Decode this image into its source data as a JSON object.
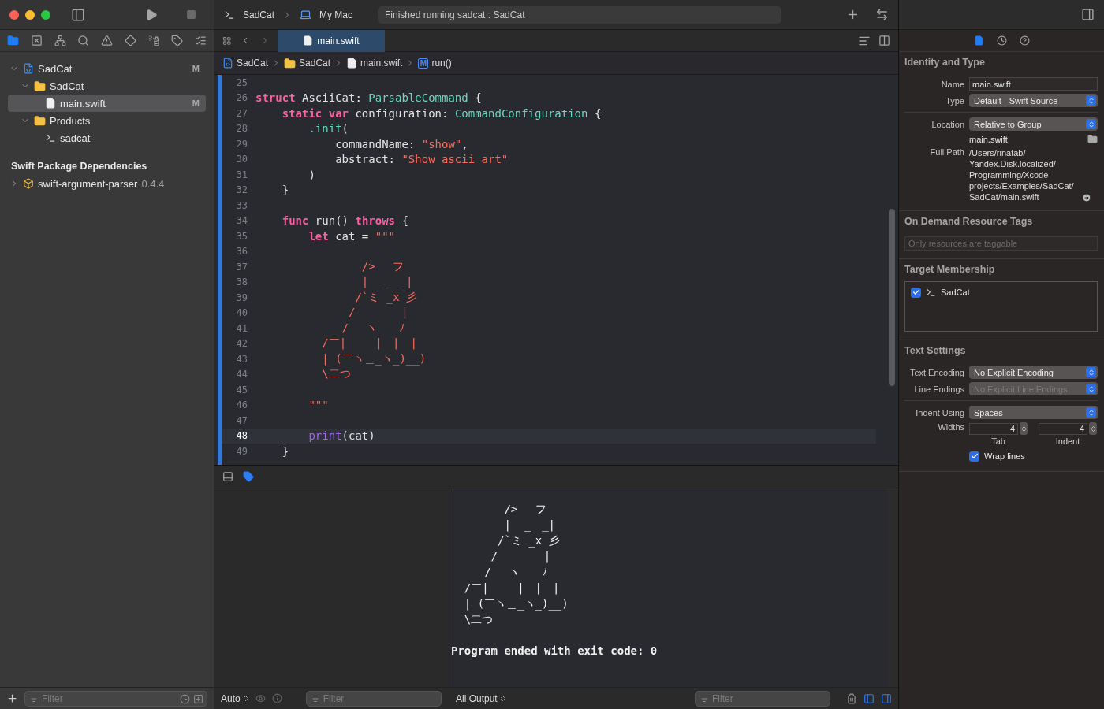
{
  "window": {
    "scheme": "SadCat",
    "destination": "My Mac",
    "status": "Finished running sadcat : SadCat"
  },
  "navigator_tabs": [
    {
      "kind": "folder",
      "selected": true
    },
    {
      "kind": "source-control",
      "selected": false
    },
    {
      "kind": "hierarchy",
      "selected": false
    },
    {
      "kind": "search",
      "selected": false
    },
    {
      "kind": "warning",
      "selected": false
    },
    {
      "kind": "test",
      "selected": false
    },
    {
      "kind": "debug",
      "selected": false
    },
    {
      "kind": "breakpoint",
      "selected": false
    },
    {
      "kind": "report",
      "selected": false
    }
  ],
  "navigator": {
    "tree": [
      {
        "name": "SadCat",
        "kind": "project",
        "badge": "M",
        "expanded": true,
        "selected": false,
        "children": [
          {
            "name": "SadCat",
            "kind": "folder",
            "expanded": true,
            "selected": false,
            "children": [
              {
                "name": "main.swift",
                "kind": "swift",
                "badge": "M",
                "selected": true
              }
            ]
          },
          {
            "name": "Products",
            "kind": "folder",
            "expanded": true,
            "selected": false,
            "children": [
              {
                "name": "sadcat",
                "kind": "executable",
                "selected": false
              }
            ]
          }
        ]
      }
    ],
    "dependencies_title": "Swift Package Dependencies",
    "packages": [
      {
        "name": "swift-argument-parser",
        "version": "0.4.4",
        "expanded": false,
        "selected": false
      }
    ],
    "filter": {
      "placeholder": "Filter"
    }
  },
  "editor": {
    "tab": "main.swift",
    "breadcrumb": [
      {
        "kind": "project",
        "label": "SadCat"
      },
      {
        "kind": "folder",
        "label": "SadCat"
      },
      {
        "kind": "swift",
        "label": "main.swift"
      },
      {
        "kind": "method",
        "icon_letter": "M",
        "label": "run()"
      }
    ],
    "lines": [
      {
        "number": "25",
        "current": false
      },
      {
        "number": "26",
        "current": false,
        "tokens": [
          {
            "kind": "keyword",
            "text": "struct"
          },
          {
            "kind": "plain",
            "text": " AsciiCat: "
          },
          {
            "kind": "type",
            "text": "ParsableCommand"
          },
          {
            "kind": "plain",
            "text": " {"
          }
        ]
      },
      {
        "number": "27",
        "current": false,
        "tokens": [
          {
            "kind": "keyword",
            "text": "    static "
          },
          {
            "kind": "keyword",
            "text": "var"
          },
          {
            "kind": "plain",
            "text": " configuration: "
          },
          {
            "kind": "type",
            "text": "CommandConfiguration"
          },
          {
            "kind": "plain",
            "text": " {"
          }
        ]
      },
      {
        "number": "28",
        "current": false,
        "tokens": [
          {
            "kind": "type",
            "text": "        .init"
          },
          {
            "kind": "plain",
            "text": "("
          }
        ]
      },
      {
        "number": "29",
        "current": false,
        "tokens": [
          {
            "kind": "plain",
            "text": "            commandName: "
          },
          {
            "kind": "string",
            "text": "\"show\""
          },
          {
            "kind": "plain",
            "text": ","
          }
        ]
      },
      {
        "number": "30",
        "current": false,
        "tokens": [
          {
            "kind": "plain",
            "text": "            abstract: "
          },
          {
            "kind": "string",
            "text": "\"Show ascii art\""
          }
        ]
      },
      {
        "number": "31",
        "current": false,
        "tokens": [
          {
            "kind": "plain",
            "text": "        )"
          }
        ]
      },
      {
        "number": "32",
        "current": false,
        "tokens": [
          {
            "kind": "plain",
            "text": "    }"
          }
        ]
      },
      {
        "number": "33",
        "current": false
      },
      {
        "number": "34",
        "current": false,
        "tokens": [
          {
            "kind": "keyword",
            "text": "    func"
          },
          {
            "kind": "plain",
            "text": " run() "
          },
          {
            "kind": "keyword",
            "text": "throws"
          },
          {
            "kind": "plain",
            "text": " {"
          }
        ]
      },
      {
        "number": "35",
        "current": false,
        "tokens": [
          {
            "kind": "keyword",
            "text": "        let"
          },
          {
            "kind": "plain",
            "text": " cat = "
          },
          {
            "kind": "string",
            "text": "\"\"\""
          }
        ]
      },
      {
        "number": "36",
        "current": false
      },
      {
        "number": "37",
        "current": false,
        "tokens": [
          {
            "kind": "string",
            "text": "                /> 　フ"
          }
        ]
      },
      {
        "number": "38",
        "current": false,
        "tokens": [
          {
            "kind": "string",
            "text": "                |  _　_|"
          }
        ]
      },
      {
        "number": "39",
        "current": false,
        "tokens": [
          {
            "kind": "string",
            "text": "               /`ミ _x 彡"
          }
        ]
      },
      {
        "number": "40",
        "current": false,
        "tokens": [
          {
            "kind": "string",
            "text": "              /　　 　 |"
          }
        ]
      },
      {
        "number": "41",
        "current": false,
        "tokens": [
          {
            "kind": "string",
            "text": "             /　 ヽ　　ﾉ"
          }
        ]
      },
      {
        "number": "42",
        "current": false,
        "tokens": [
          {
            "kind": "string",
            "text": "          /￣|　　 |　|　|"
          }
        ]
      },
      {
        "number": "43",
        "current": false,
        "tokens": [
          {
            "kind": "string",
            "text": "          | (￣ヽ＿_ヽ_)__)"
          }
        ]
      },
      {
        "number": "44",
        "current": false,
        "tokens": [
          {
            "kind": "string",
            "text": "          \\二つ"
          }
        ]
      },
      {
        "number": "45",
        "current": false
      },
      {
        "number": "46",
        "current": false,
        "tokens": [
          {
            "kind": "string",
            "text": "        \"\"\""
          }
        ]
      },
      {
        "number": "47",
        "current": false
      },
      {
        "number": "48",
        "current": true,
        "tokens": [
          {
            "kind": "call",
            "text": "        print"
          },
          {
            "kind": "plain",
            "text": "(cat)"
          }
        ]
      },
      {
        "number": "49",
        "current": false,
        "tokens": [
          {
            "kind": "plain",
            "text": "    }"
          }
        ]
      }
    ]
  },
  "debug": {
    "scope": "Auto",
    "variables_filter": {
      "placeholder": "Filter"
    },
    "output_mode": "All Output",
    "console_filter": {
      "placeholder": "Filter"
    },
    "console_lines": [
      "        /> 　フ",
      "        |  _　_|",
      "       /`ミ _x 彡",
      "      /　　 　 |",
      "     /　 ヽ　　ﾉ",
      "  /￣|　　 |　|　|",
      "  | (￣ヽ＿_ヽ_)__)",
      "  \\二つ"
    ],
    "exit_message": "Program ended with exit code: 0"
  },
  "inspector_tabs": [
    {
      "kind": "file",
      "selected": true
    },
    {
      "kind": "history",
      "selected": false
    },
    {
      "kind": "help",
      "selected": false
    }
  ],
  "inspector": {
    "identity": {
      "title": "Identity and Type",
      "name_label": "Name",
      "name_value": "main.swift",
      "type_label": "Type",
      "type_value": "Default - Swift Source",
      "location_label": "Location",
      "location_value": "Relative to Group",
      "file_name": "main.swift",
      "full_path_label": "Full Path",
      "full_path_lines": [
        "/Users/rinatab/",
        "Yandex.Disk.localized/",
        "Programming/Xcode",
        "projects/Examples/SadCat/",
        "SadCat/main.swift"
      ]
    },
    "tags": {
      "title": "On Demand Resource Tags",
      "placeholder": "Only resources are taggable"
    },
    "membership": {
      "title": "Target Membership",
      "targets": [
        {
          "name": "SadCat",
          "checked": true
        }
      ]
    },
    "text_settings": {
      "title": "Text Settings",
      "encoding_label": "Text Encoding",
      "encoding_value": "No Explicit Encoding",
      "line_endings_label": "Line Endings",
      "line_endings_value": "No Explicit Line Endings",
      "line_endings_disabled": true,
      "indent_label": "Indent Using",
      "indent_value": "Spaces",
      "widths_label": "Widths",
      "tab_value": "4",
      "tab_label": "Tab",
      "indent_width_value": "4",
      "indent_width_label": "Indent",
      "wrap_label": "Wrap lines",
      "wrap_checked": true
    }
  }
}
